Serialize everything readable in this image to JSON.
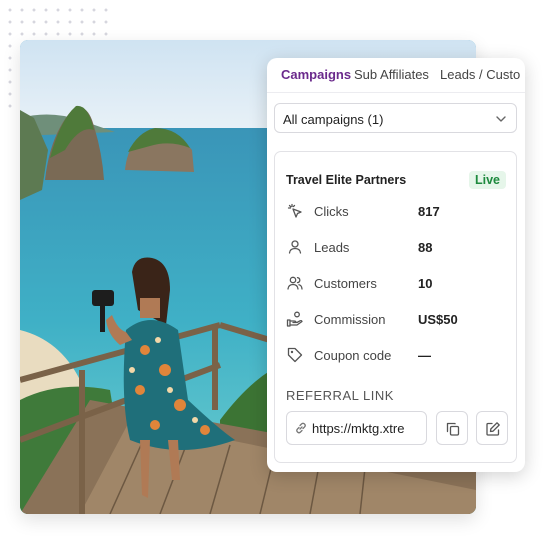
{
  "tabs": [
    {
      "label": "Campaigns",
      "active": true
    },
    {
      "label": "Sub Affiliates",
      "active": false
    },
    {
      "label": "Leads / Custo",
      "active": false
    }
  ],
  "campaign_select": {
    "value": "All campaigns (1)"
  },
  "campaign": {
    "name": "Travel Elite Partners",
    "status": "Live",
    "stats": [
      {
        "icon": "cursor-click-icon",
        "label": "Clicks",
        "value": "817"
      },
      {
        "icon": "user-icon",
        "label": "Leads",
        "value": "88"
      },
      {
        "icon": "users-icon",
        "label": "Customers",
        "value": "10"
      },
      {
        "icon": "hand-coins-icon",
        "label": "Commission",
        "value": "US$50"
      },
      {
        "icon": "tag-icon",
        "label": "Coupon code",
        "value": "—"
      }
    ]
  },
  "referral": {
    "title": "REFERRAL LINK",
    "url": "https://mktg.xtre"
  },
  "colors": {
    "accent": "#6b2a8c",
    "live_bg": "#e6f6ea",
    "live_text": "#1e8a3e"
  }
}
